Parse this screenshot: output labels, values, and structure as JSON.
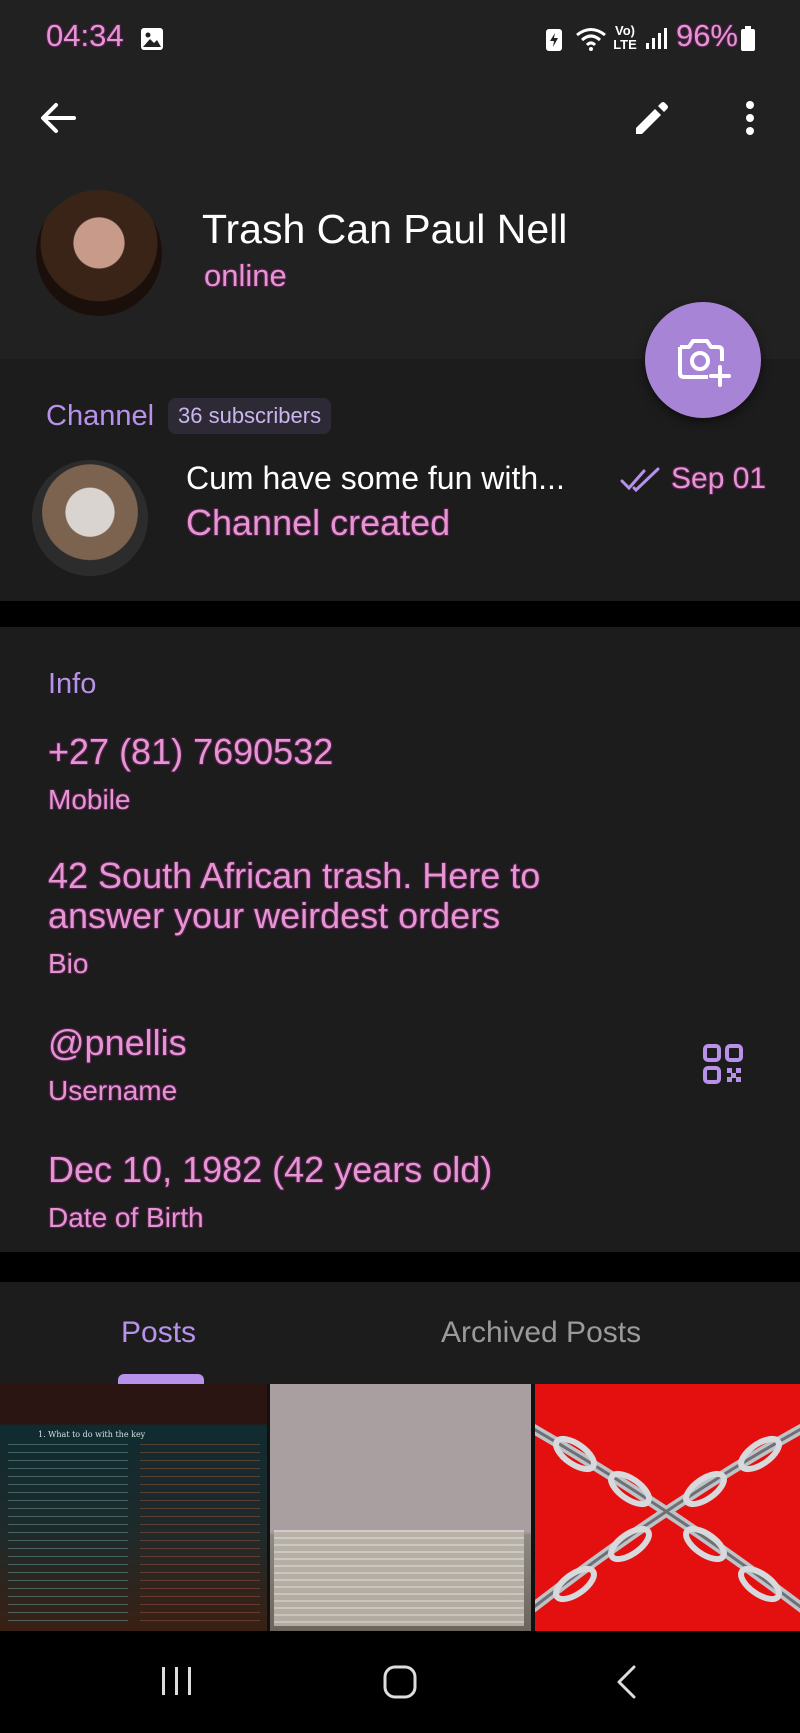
{
  "status_bar": {
    "time": "04:34",
    "battery": "96%",
    "network_label": "Vo) LTE"
  },
  "profile": {
    "name": "Trash Can Paul Nell",
    "status": "online"
  },
  "channel": {
    "label": "Channel",
    "subscribers": "36 subscribers",
    "title": "Cum have some fun with...",
    "subtitle": "Channel created",
    "date": "Sep 01"
  },
  "info": {
    "heading": "Info",
    "phone": "+27 (81) 7690532",
    "phone_label": "Mobile",
    "bio_line1": "42 South African trash. Here to",
    "bio_line2": "answer your weirdest orders",
    "bio_label": "Bio",
    "username": "@pnellis",
    "username_label": "Username",
    "dob": "Dec 10, 1982 (42 years old)",
    "dob_label": "Date of Birth"
  },
  "tabs": [
    {
      "label": "Posts",
      "active": true
    },
    {
      "label": "Archived Posts",
      "active": false
    }
  ],
  "media_thumb_text": "1. What to do with the key",
  "colors": {
    "accent": "#b892ea",
    "pink_text": "#e596d2",
    "fab": "#a884d6",
    "background": "#1c1c1c"
  },
  "icons": [
    "back-arrow-icon",
    "pencil-icon",
    "more-vert-icon",
    "camera-add-icon",
    "double-check-icon",
    "qr-code-icon",
    "recents-icon",
    "home-icon",
    "nav-back-icon",
    "image-icon",
    "wifi-icon",
    "signal-icon",
    "battery-icon"
  ]
}
